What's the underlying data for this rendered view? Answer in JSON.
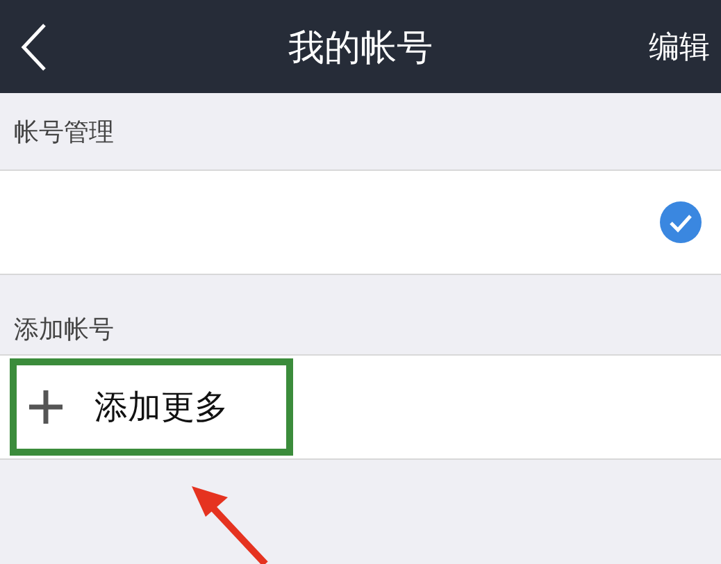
{
  "header": {
    "title": "我的帐号",
    "action": "编辑"
  },
  "sections": [
    {
      "heading": "帐号管理",
      "rows": [
        {
          "kind": "account",
          "checked": true
        }
      ]
    },
    {
      "heading": "添加帐号",
      "rows": [
        {
          "kind": "add",
          "label": "添加更多",
          "highlighted": true
        }
      ]
    }
  ]
}
